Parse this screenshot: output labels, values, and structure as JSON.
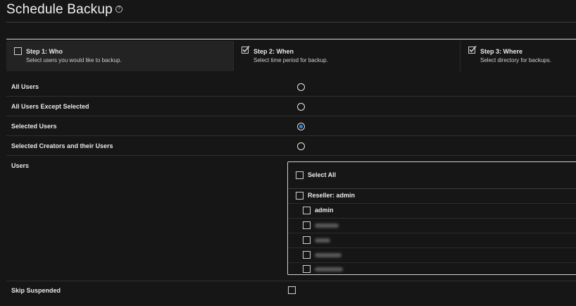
{
  "header": {
    "title": "Schedule Backup",
    "help_icon": "?"
  },
  "steps": [
    {
      "title": "Step 1: Who",
      "subtitle": "Select users you would like to backup.",
      "checked": false,
      "active": true
    },
    {
      "title": "Step 2: When",
      "subtitle": "Select time period for backup.",
      "checked": true,
      "active": false
    },
    {
      "title": "Step 3: Where",
      "subtitle": "Select directory for backups.",
      "checked": true,
      "active": false
    }
  ],
  "options": {
    "all_users": "All Users",
    "all_except": "All Users Except Selected",
    "selected_users": "Selected Users",
    "selected_creators": "Selected Creators and their Users",
    "selected": "selected_users"
  },
  "users": {
    "label": "Users",
    "select_all": "Select All",
    "reseller": "Reseller: admin",
    "items": [
      "admin"
    ]
  },
  "skip_suspended": {
    "label": "Skip Suspended",
    "checked": false
  }
}
